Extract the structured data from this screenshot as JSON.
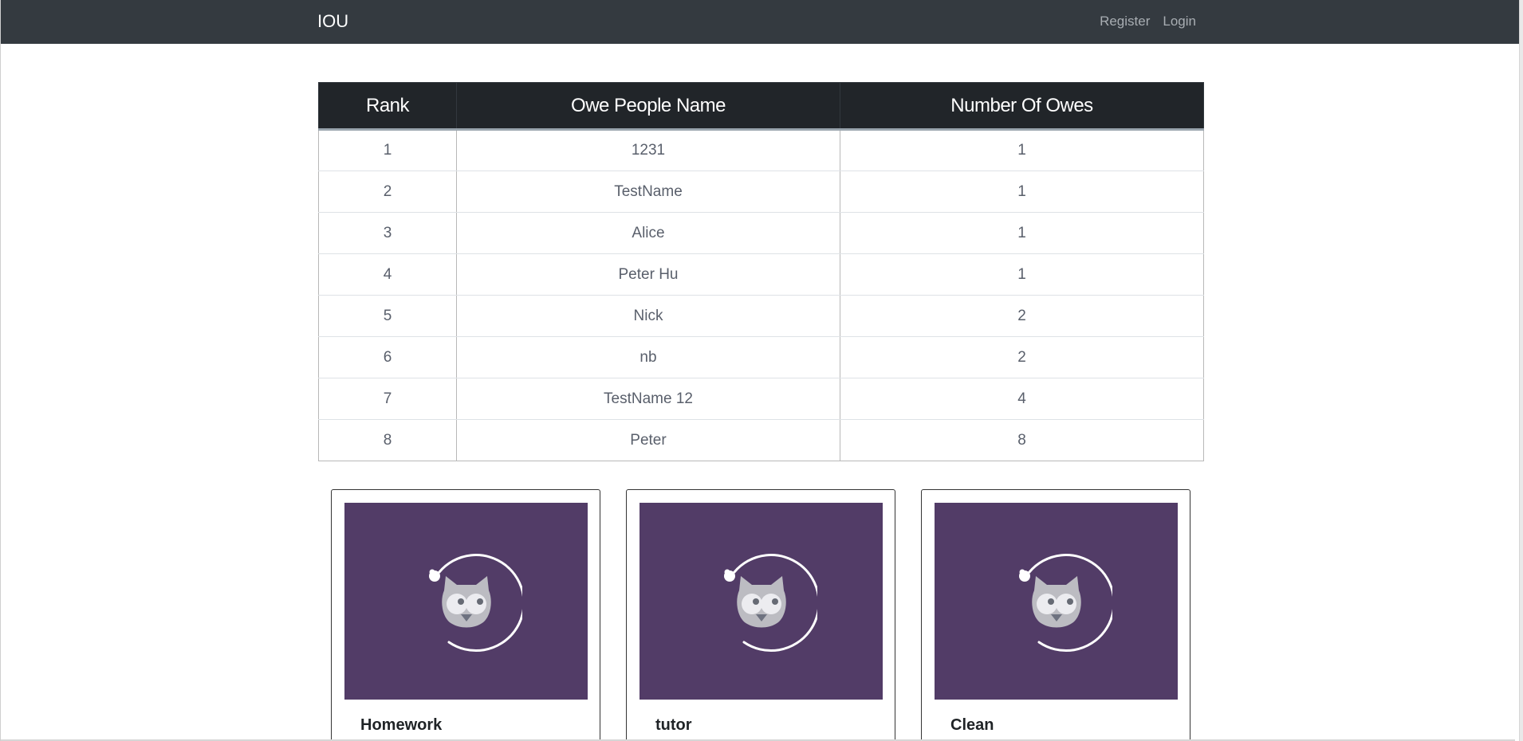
{
  "navbar": {
    "brand": "IOU",
    "links": [
      "Register",
      "Login"
    ]
  },
  "table": {
    "headers": [
      "Rank",
      "Owe People Name",
      "Number Of Owes"
    ],
    "rows": [
      [
        "1",
        "1231",
        "1"
      ],
      [
        "2",
        "TestName",
        "1"
      ],
      [
        "3",
        "Alice",
        "1"
      ],
      [
        "4",
        "Peter Hu",
        "1"
      ],
      [
        "5",
        "Nick",
        "2"
      ],
      [
        "6",
        "nb",
        "2"
      ],
      [
        "7",
        "TestName 12",
        "4"
      ],
      [
        "8",
        "Peter",
        "8"
      ]
    ]
  },
  "cards": [
    {
      "title": "Homework",
      "image_icon": "cat-logo-icon"
    },
    {
      "title": "tutor",
      "image_icon": "cat-logo-icon"
    },
    {
      "title": "Clean",
      "image_icon": "cat-logo-icon"
    }
  ],
  "colors": {
    "navbar_bg": "#343a40",
    "table_header_bg": "#212529",
    "card_image_bg": "#523c67"
  }
}
